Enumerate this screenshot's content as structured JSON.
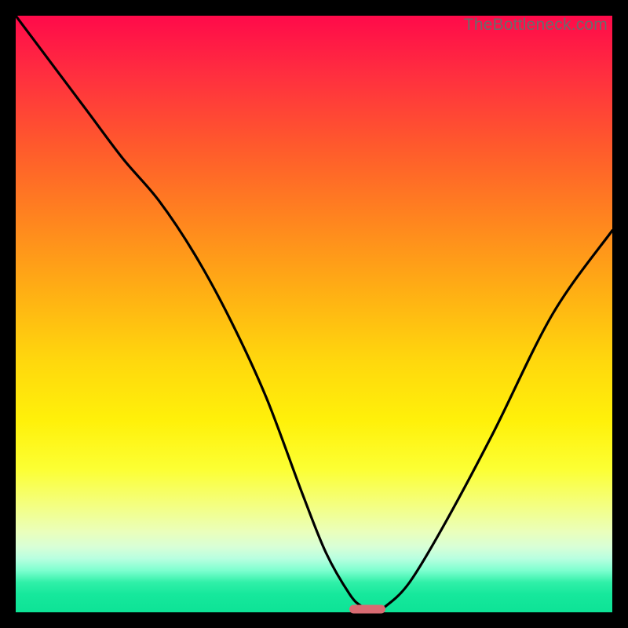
{
  "watermark": "TheBottleneck.com",
  "colors": {
    "curve_stroke": "#000000",
    "marker_fill": "#d96b72",
    "background_frame": "#000000"
  },
  "chart_data": {
    "type": "line",
    "title": "",
    "xlabel": "",
    "ylabel": "",
    "xlim": [
      0,
      100
    ],
    "ylim": [
      0,
      100
    ],
    "grid": false,
    "legend": false,
    "annotations": [
      "TheBottleneck.com"
    ],
    "series": [
      {
        "name": "bottleneck-curve",
        "x": [
          0,
          6,
          12,
          18,
          24,
          30,
          36,
          42,
          48,
          52,
          56,
          58,
          60,
          62,
          66,
          72,
          80,
          90,
          100
        ],
        "y": [
          100,
          92,
          84,
          76,
          69,
          60,
          49,
          36,
          20,
          10,
          3,
          1,
          0,
          1,
          5,
          15,
          30,
          50,
          64
        ]
      }
    ],
    "optimum": {
      "x": 59,
      "y": 0
    },
    "gradient_stops": [
      {
        "pos": 0,
        "color": "#ff0a4a"
      },
      {
        "pos": 22,
        "color": "#ff5a2c"
      },
      {
        "pos": 46,
        "color": "#ffae14"
      },
      {
        "pos": 68,
        "color": "#fff10a"
      },
      {
        "pos": 88,
        "color": "#e0ffc8"
      },
      {
        "pos": 100,
        "color": "#0de396"
      }
    ]
  }
}
